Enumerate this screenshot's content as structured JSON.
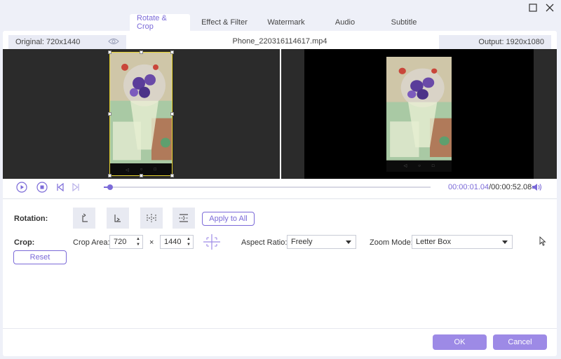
{
  "tabs": [
    "Rotate & Crop",
    "Effect & Filter",
    "Watermark",
    "Audio",
    "Subtitle"
  ],
  "info": {
    "original": "Original: 720x1440",
    "file_name": "Phone_220316114617.mp4",
    "output": "Output: 1920x1080"
  },
  "player": {
    "current_time": "00:00:01.04",
    "total_time": "/00:00:52.08",
    "progress": 0.02
  },
  "rotation": {
    "label": "Rotation:",
    "apply_all": "Apply to All"
  },
  "crop": {
    "label": "Crop:",
    "area_label": "Crop Area:",
    "width": "720",
    "times": "×",
    "height": "1440",
    "aspect_label": "Aspect Ratio:",
    "aspect_value": "Freely",
    "zoom_label": "Zoom Mode:",
    "zoom_value": "Letter Box",
    "reset": "Reset"
  },
  "footer": {
    "ok": "OK",
    "cancel": "Cancel"
  },
  "colors": {
    "accent": "#7b6ad8",
    "button_fill": "#9d8ae6",
    "crop_border": "#e6d32f"
  }
}
